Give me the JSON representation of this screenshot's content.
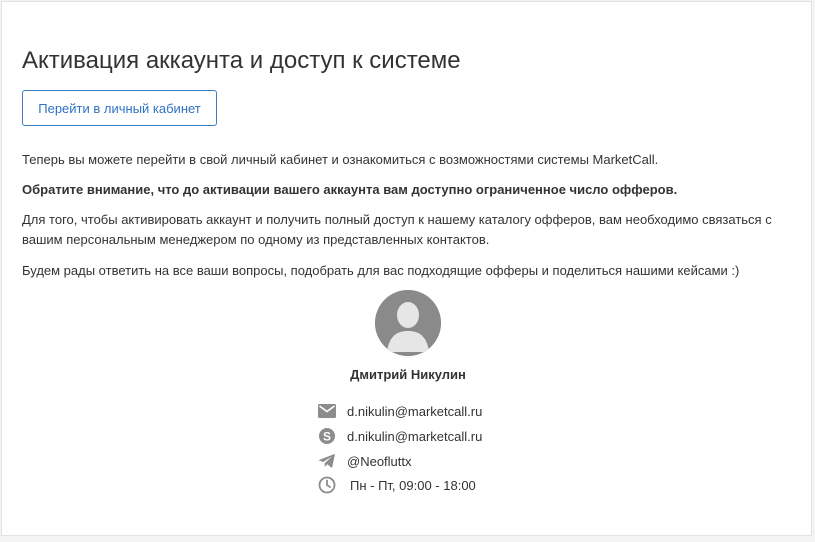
{
  "page": {
    "title": "Активация аккаунта и доступ к системе",
    "cabinet_button_label": "Перейти в личный кабинет"
  },
  "text": {
    "intro": "Теперь вы можете перейти в свой личный кабинет и ознакомиться с возможностями системы MarketCall.",
    "notice": "Обратите внимание, что до активации вашего аккаунта вам доступно ограниченное число офферов.",
    "instructions": "Для того, чтобы активировать аккаунт и получить полный доступ к нашему каталогу офферов, вам необходимо связаться с вашим персональным менеджером по одному из представленных контактов.",
    "closing": "Будем рады ответить на все ваши вопросы, подобрать для вас подходящие офферы и поделиться нашими кейсами :)"
  },
  "manager": {
    "name": "Дмитрий Никулин",
    "contacts": [
      {
        "icon": "envelope-icon",
        "value": "d.nikulin@marketcall.ru"
      },
      {
        "icon": "skype-icon",
        "value": "d.nikulin@marketcall.ru"
      },
      {
        "icon": "telegram-icon",
        "value": "@Neofluttx"
      },
      {
        "icon": "clock-icon",
        "value": "Пн - Пт, 09:00 - 18:00"
      }
    ]
  },
  "colors": {
    "accent": "#2f72c2",
    "icon_gray": "#8c8c8c",
    "avatar_gray": "#8a8a8a"
  }
}
